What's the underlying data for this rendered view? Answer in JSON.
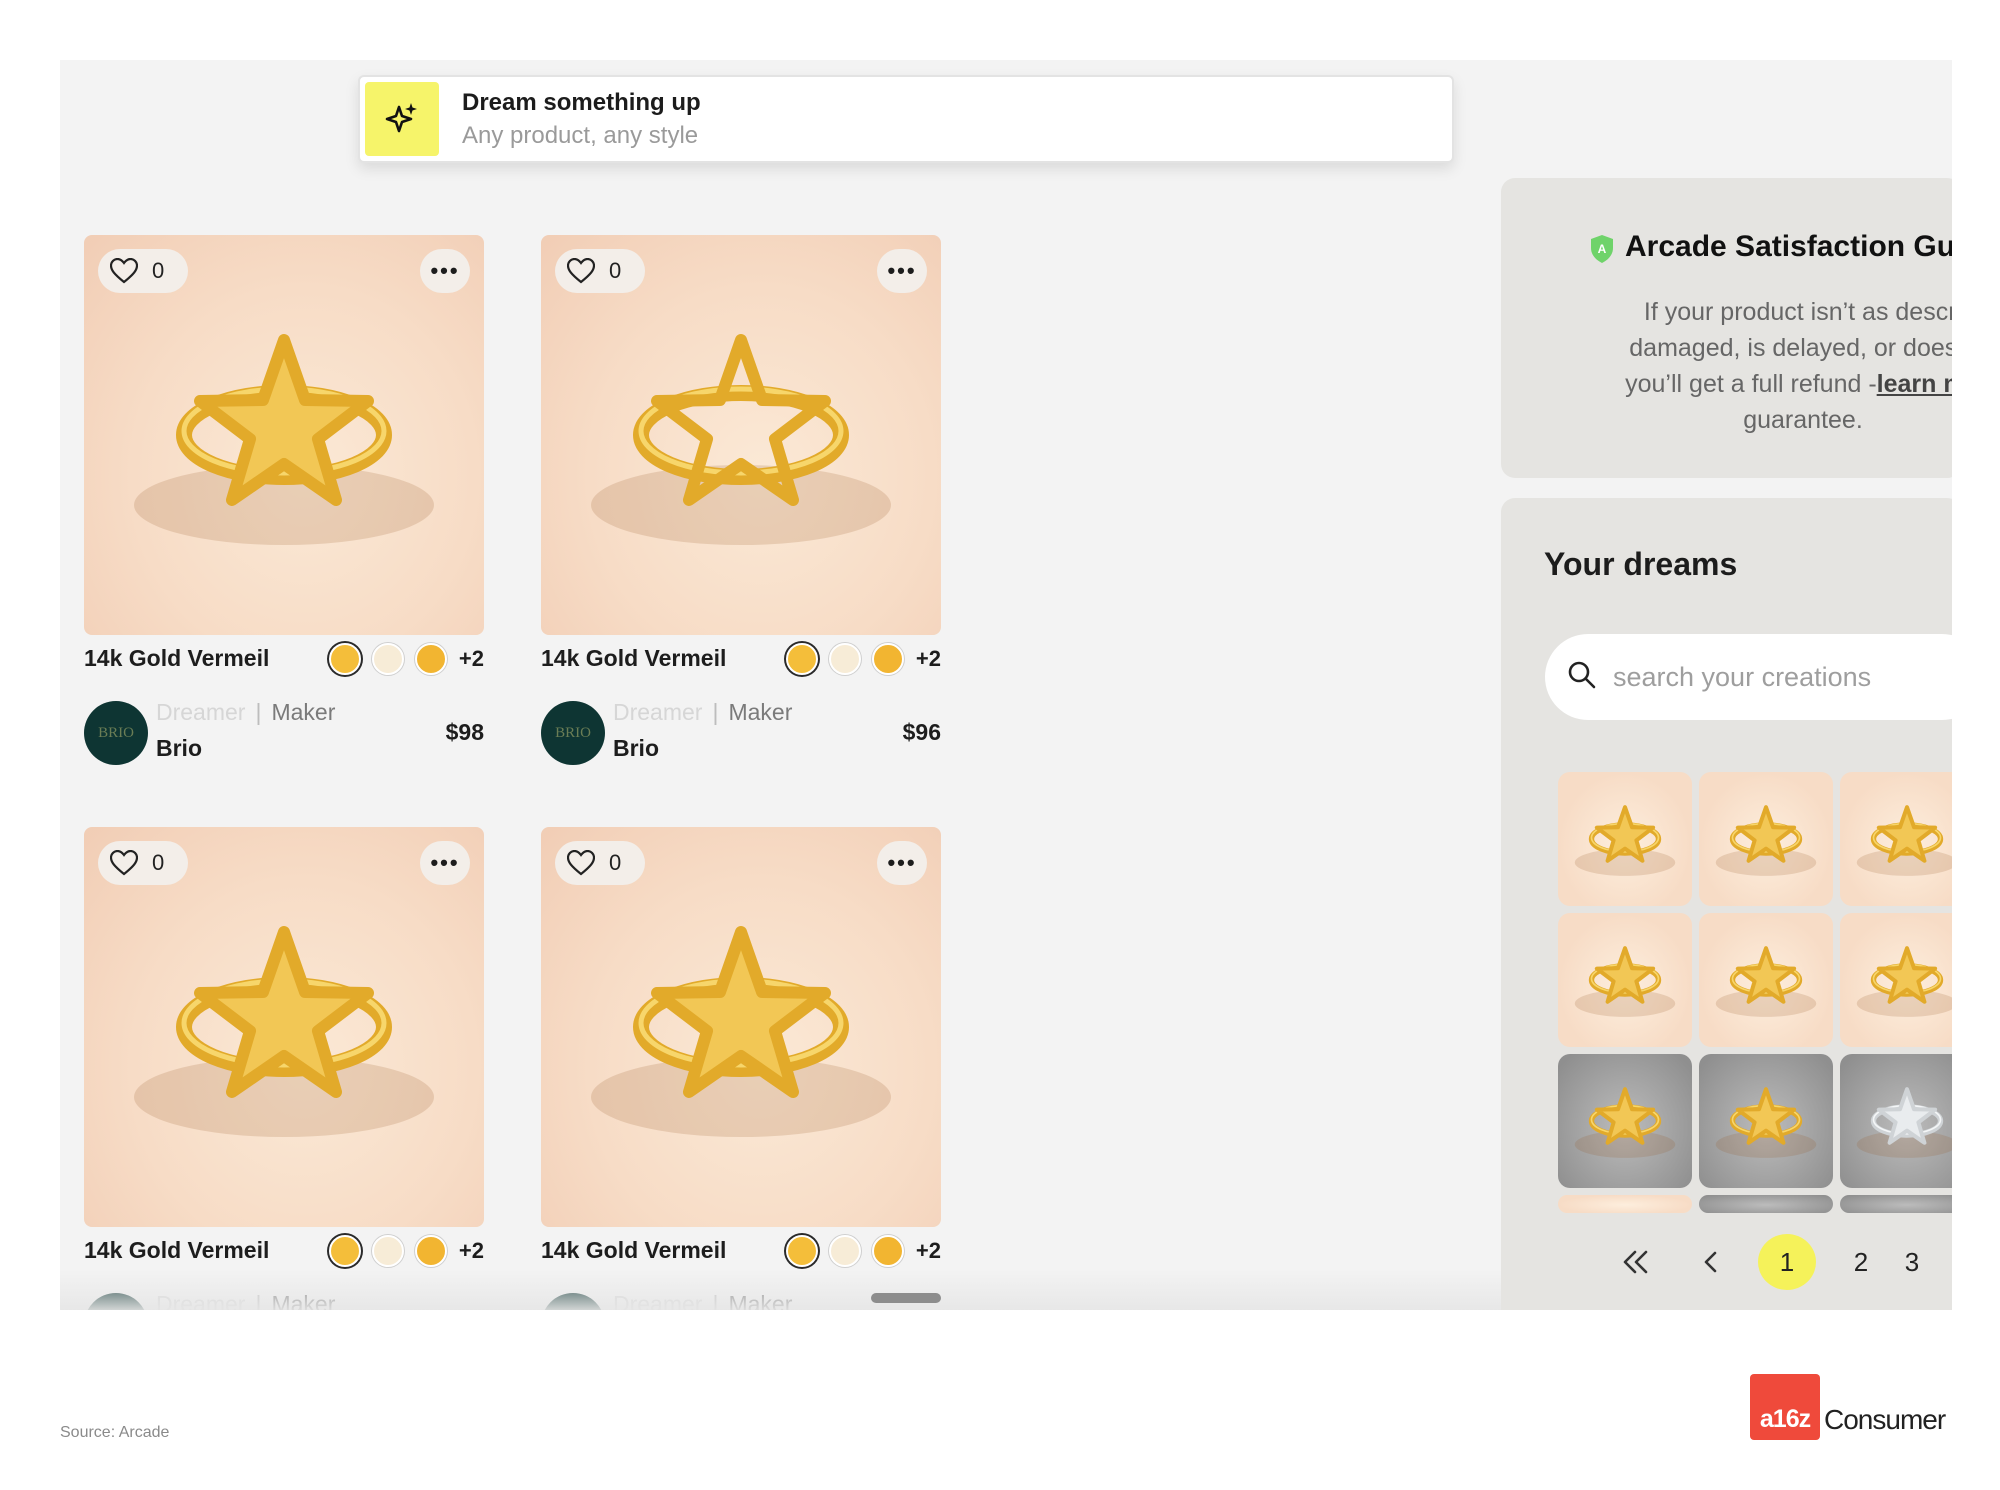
{
  "dream_bar": {
    "title": "Dream something up",
    "subtitle": "Any product, any style",
    "icon": "sparkles-icon",
    "accent_color": "#f6f46a"
  },
  "products": [
    {
      "likes": "0",
      "title": "14k Gold Vermeil",
      "swatches": [
        "#f4be3a",
        "#f7ecd7",
        "#f2b531"
      ],
      "more_count": "+2",
      "role_dreamer": "Dreamer",
      "role_maker": "Maker",
      "maker_name": "Brio",
      "avatar_text": "BRIO",
      "price": "$98"
    },
    {
      "likes": "0",
      "title": "14k Gold Vermeil",
      "swatches": [
        "#f4be3a",
        "#f7ecd7",
        "#f2b531"
      ],
      "more_count": "+2",
      "role_dreamer": "Dreamer",
      "role_maker": "Maker",
      "maker_name": "Brio",
      "avatar_text": "BRIO",
      "price": "$96"
    },
    {
      "likes": "0",
      "title": "14k Gold Vermeil",
      "swatches": [
        "#f4be3a",
        "#f7ecd7",
        "#f2b531"
      ],
      "more_count": "+2",
      "role_dreamer": "Dreamer",
      "role_maker": "Maker"
    },
    {
      "likes": "0",
      "title": "14k Gold Vermeil",
      "swatches": [
        "#f4be3a",
        "#f7ecd7",
        "#f2b531"
      ],
      "more_count": "+2",
      "role_dreamer": "Dreamer",
      "role_maker": "Maker"
    }
  ],
  "guarantee": {
    "title": "Arcade Satisfaction Gu",
    "line1": "If your product isn’t as descri",
    "line2": "damaged, is delayed, or doesn’",
    "line3_prefix": "you’ll get a full refund -",
    "line3_link": "learn mo",
    "line4": "guarantee.",
    "icon": "shield-icon",
    "icon_color": "#6fd36a"
  },
  "your_dreams": {
    "title": "Your dreams",
    "search_placeholder": "search your creations",
    "thumbnails": [
      {
        "kind": "warm",
        "subject": "gold star ring"
      },
      {
        "kind": "warm",
        "subject": "gold star ring"
      },
      {
        "kind": "warm",
        "subject": "gold star ring"
      },
      {
        "kind": "warm",
        "subject": "gold star ring"
      },
      {
        "kind": "warm",
        "subject": "gold star ring"
      },
      {
        "kind": "warm",
        "subject": "gold star ring"
      },
      {
        "kind": "grey",
        "subject": "gold star ring"
      },
      {
        "kind": "grey",
        "subject": "gold star ring"
      },
      {
        "kind": "grey",
        "subject": "silver star ring"
      }
    ],
    "pagination": {
      "first_icon": "double-chevron-left-icon",
      "prev_icon": "chevron-left-icon",
      "pages": [
        "1",
        "2",
        "3"
      ],
      "current": "1",
      "active_color": "#f5f25a"
    }
  },
  "footer": {
    "source": "Source: Arcade",
    "logo_mark": "a16z",
    "logo_word": "Consumer",
    "logo_color": "#ef4a3b"
  }
}
